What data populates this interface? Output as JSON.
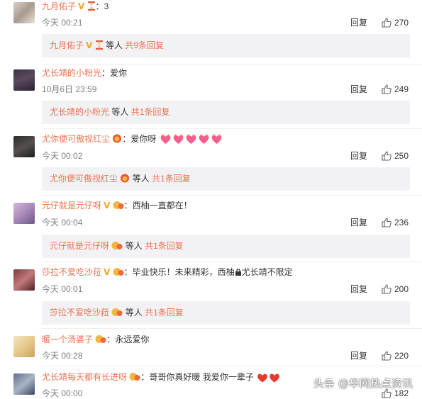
{
  "comments": [
    {
      "user": "九月佑子",
      "text": "：3",
      "time": "今天 00:21",
      "likes": "270",
      "sub_user": "九月佑子",
      "sub_text": "等人",
      "sub_count": "共9条回复"
    },
    {
      "user": "尤长靖的小粉光",
      "text": "：爱你",
      "time": "10月6日 23:59",
      "likes": "249",
      "sub_user": "尤长靖的小粉光",
      "sub_text": "等人",
      "sub_count": "共1条回复"
    },
    {
      "user": "尤你便可傲视红尘",
      "text": "：爱你呀",
      "time": "今天 00:02",
      "likes": "250",
      "sub_user": "尤你便可傲视红尘",
      "sub_text": "等人",
      "sub_count": "共1条回复"
    },
    {
      "user": "元仔就是元仔呀",
      "text": "：西柚一直都在！",
      "time": "今天 00:04",
      "likes": "236",
      "sub_user": "元仔就是元仔呀",
      "sub_text": "等人",
      "sub_count": "共1条回复"
    },
    {
      "user": "莎拉不爱吃沙菈",
      "text": "：毕业快乐！未来精彩，西柚",
      "text2": "尤长靖不限定",
      "time": "今天 00:01",
      "likes": "200",
      "sub_user": "莎拉不爱吃沙菈",
      "sub_text": "等人",
      "sub_count": "共1条回复"
    },
    {
      "user": "暖一个汤婆子",
      "text": "：永远爱你",
      "time": "今天 00:28",
      "likes": "220"
    },
    {
      "user": "尤长靖每天都有长进呀",
      "text": "：哥哥你真好暖 我爱你一辈子",
      "time": "今天 00:00",
      "likes": "182"
    }
  ],
  "reply_label": "回复",
  "watermark": "头条 @华网热点资讯",
  "colors": {
    "username": "#eb7350",
    "vip": "#f5a623",
    "subbox": "#f2f2f5"
  }
}
